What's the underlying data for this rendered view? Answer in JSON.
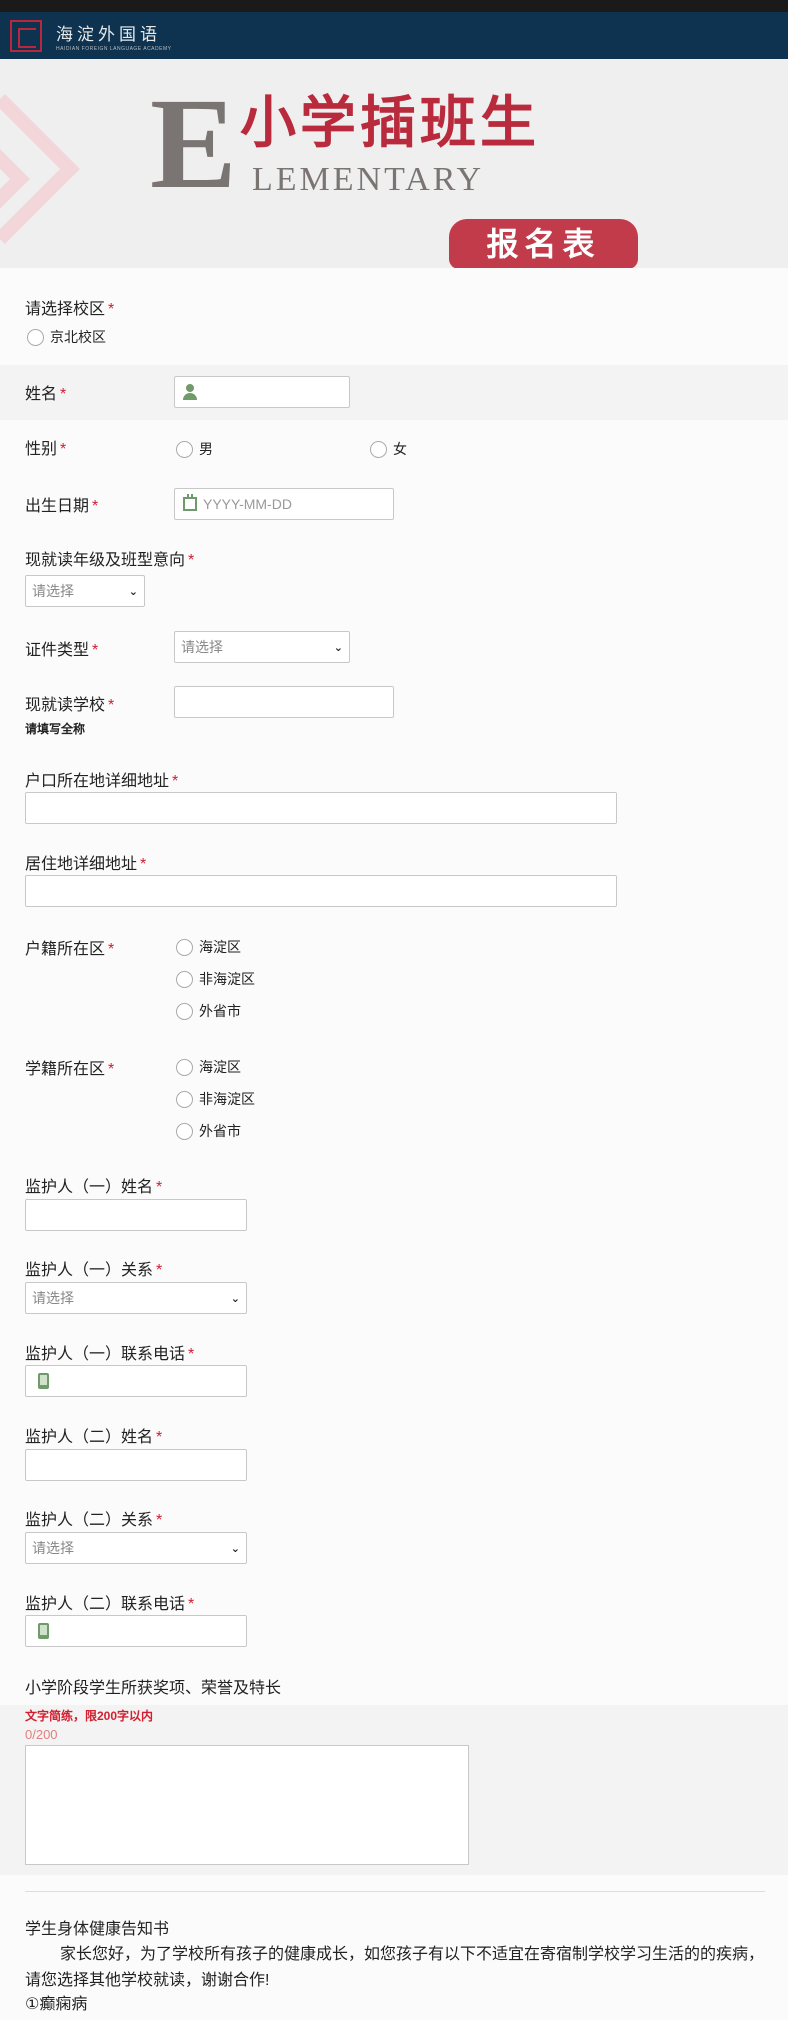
{
  "header": {
    "logo_cn": "海淀外国语",
    "logo_en": "HAIDIAN FOREIGN LANGUAGE ACADEMY"
  },
  "banner": {
    "big_letter": "E",
    "title_cn": "小学插班生",
    "title_en": "LEMENTARY",
    "badge": "报名表"
  },
  "required_mark": "*",
  "form": {
    "campus": {
      "label": "请选择校区",
      "options": [
        "京北校区"
      ]
    },
    "name": {
      "label": "姓名"
    },
    "gender": {
      "label": "性别",
      "options": [
        "男",
        "女"
      ]
    },
    "birthday": {
      "label": "出生日期",
      "placeholder": "YYYY-MM-DD"
    },
    "grade": {
      "label": "现就读年级及班型意向",
      "placeholder": "请选择"
    },
    "id_type": {
      "label": "证件类型",
      "placeholder": "请选择"
    },
    "school": {
      "label": "现就读学校",
      "hint": "请填写全称"
    },
    "hukou_address": {
      "label": "户口所在地详细地址"
    },
    "residence_address": {
      "label": "居住地详细地址"
    },
    "hukou_district": {
      "label": "户籍所在区",
      "options": [
        "海淀区",
        "非海淀区",
        "外省市"
      ]
    },
    "school_district": {
      "label": "学籍所在区",
      "options": [
        "海淀区",
        "非海淀区",
        "外省市"
      ]
    },
    "guardian1_name": {
      "label": "监护人（一）姓名"
    },
    "guardian1_relation": {
      "label": "监护人（一）关系",
      "placeholder": "请选择"
    },
    "guardian1_phone": {
      "label": "监护人（一）联系电话"
    },
    "guardian2_name": {
      "label": "监护人（二）姓名"
    },
    "guardian2_relation": {
      "label": "监护人（二）关系",
      "placeholder": "请选择"
    },
    "guardian2_phone": {
      "label": "监护人（二）联系电话"
    },
    "awards": {
      "label": "小学阶段学生所获奖项、荣誉及特长",
      "hint": "文字简练，限200字以内",
      "counter": "0/200"
    }
  },
  "health_notice": {
    "title": "学生身体健康告知书",
    "body": "家长您好，为了学校所有孩子的健康成长，如您孩子有以下不适宜在寄宿制学校学习生活的的疾病，请您选择其他学校就读，谢谢合作!",
    "item1": "①癫痫病"
  },
  "colors": {
    "header_bg": "#0e3350",
    "brand_red": "#b82a3c",
    "required": "#d21f2f",
    "icon_green": "#6f9b6a"
  }
}
